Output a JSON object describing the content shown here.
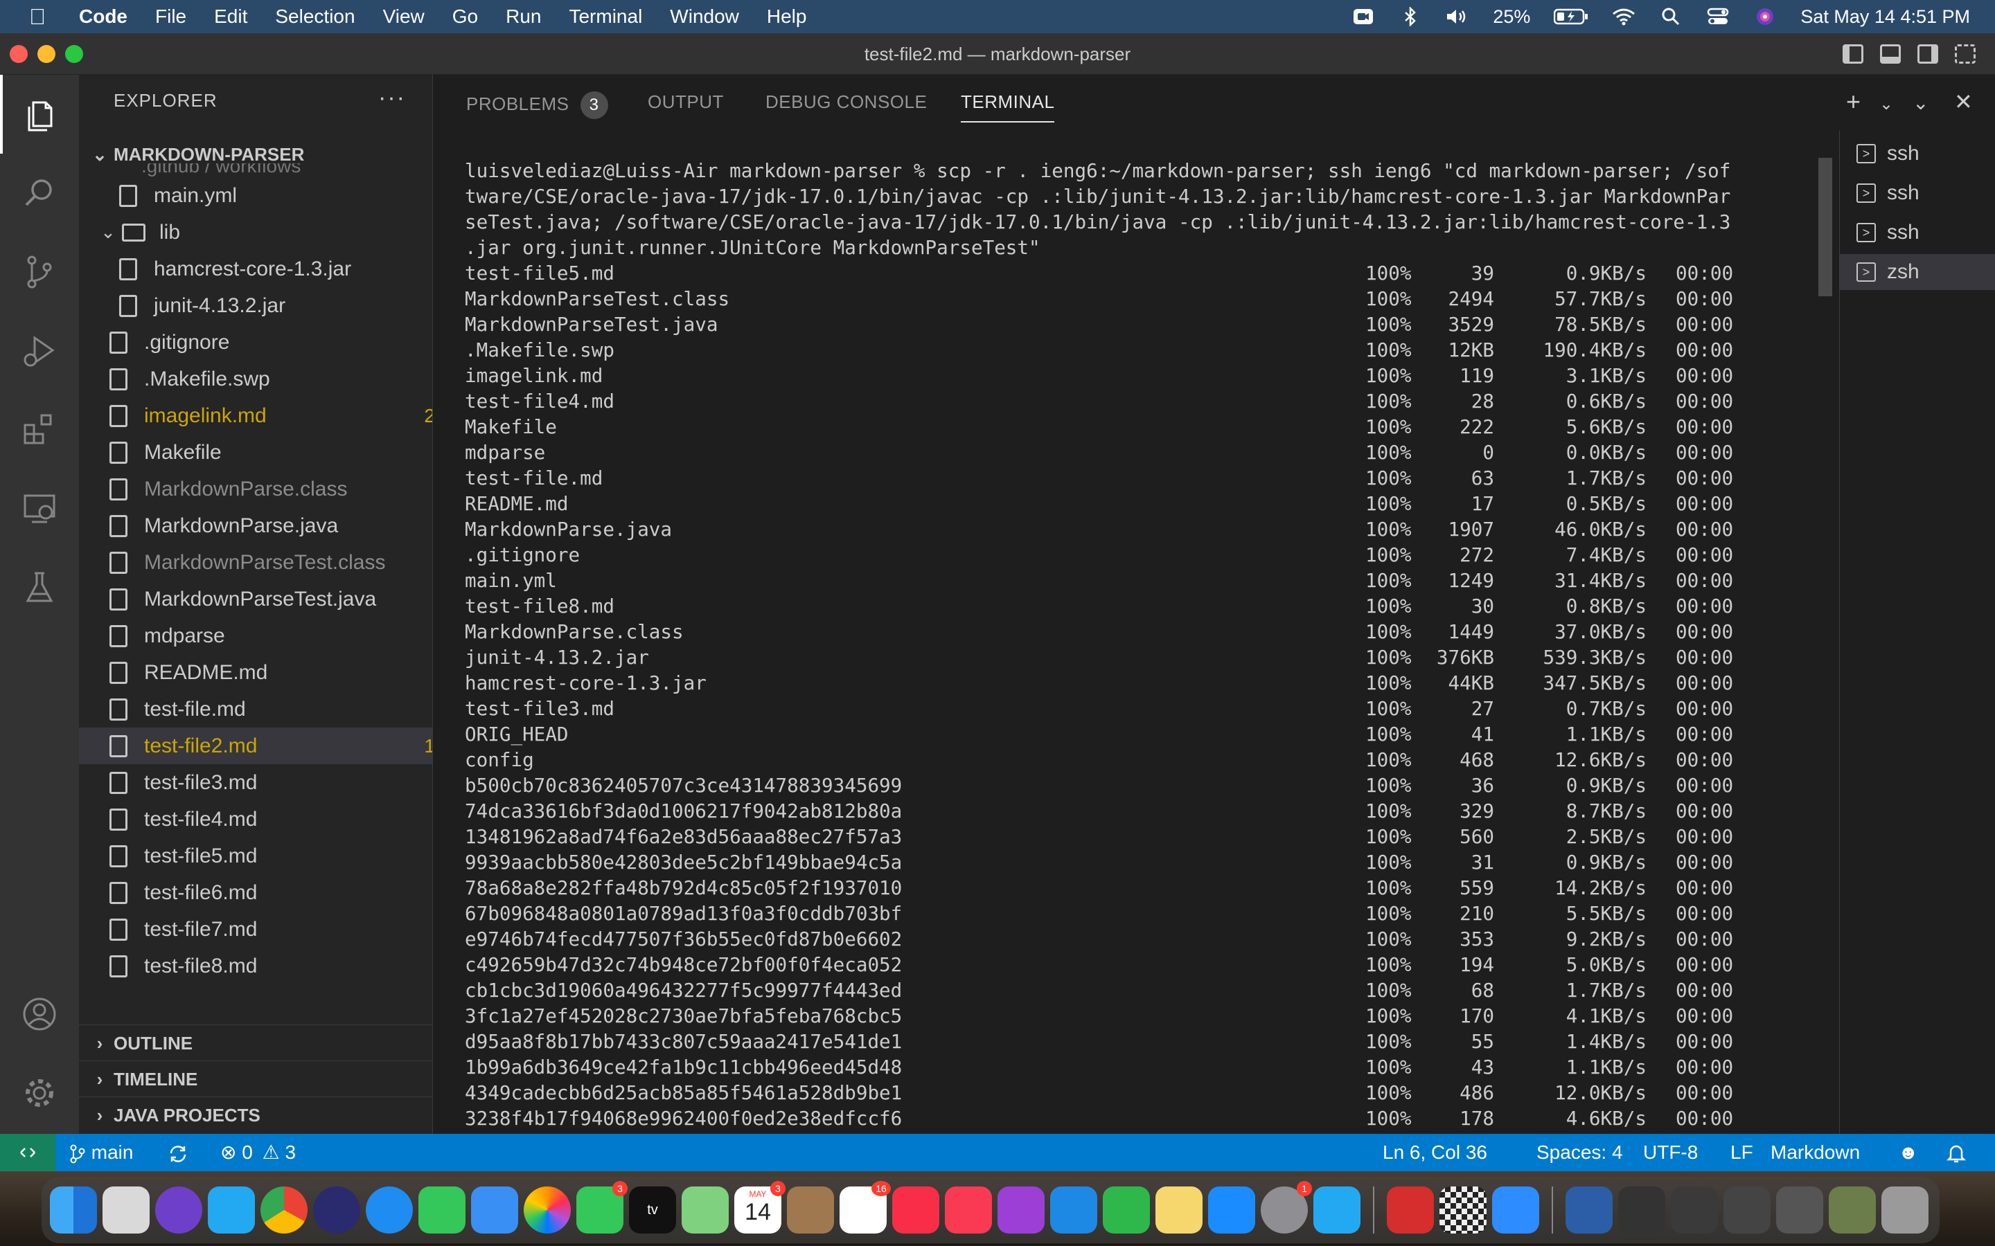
{
  "menubar": {
    "app_name": "Code",
    "items": [
      "File",
      "Edit",
      "Selection",
      "View",
      "Go",
      "Run",
      "Terminal",
      "Window",
      "Help"
    ],
    "battery": "25%",
    "clock": "Sat May 14  4:51 PM"
  },
  "window": {
    "title": "test-file2.md — markdown-parser"
  },
  "explorer": {
    "header": "EXPLORER",
    "more": "···",
    "project": "MARKDOWN-PARSER",
    "partial_folder": ".github / workflows",
    "files": [
      {
        "label": "main.yml",
        "badge": "",
        "type": "file",
        "state": "normal"
      },
      {
        "label": "lib",
        "badge": "",
        "type": "folder",
        "state": "normal"
      },
      {
        "label": "hamcrest-core-1.3.jar",
        "badge": "",
        "type": "file",
        "state": "normal"
      },
      {
        "label": "junit-4.13.2.jar",
        "badge": "",
        "type": "file",
        "state": "normal"
      },
      {
        "label": ".gitignore",
        "badge": "",
        "type": "file",
        "state": "normal"
      },
      {
        "label": ".Makefile.swp",
        "badge": "",
        "type": "file",
        "state": "normal"
      },
      {
        "label": "imagelink.md",
        "badge": "2",
        "type": "file",
        "state": "warning"
      },
      {
        "label": "Makefile",
        "badge": "",
        "type": "file",
        "state": "normal"
      },
      {
        "label": "MarkdownParse.class",
        "badge": "",
        "type": "file",
        "state": "ignored"
      },
      {
        "label": "MarkdownParse.java",
        "badge": "",
        "type": "file",
        "state": "normal"
      },
      {
        "label": "MarkdownParseTest.class",
        "badge": "",
        "type": "file",
        "state": "ignored"
      },
      {
        "label": "MarkdownParseTest.java",
        "badge": "",
        "type": "file",
        "state": "normal"
      },
      {
        "label": "mdparse",
        "badge": "",
        "type": "file",
        "state": "normal"
      },
      {
        "label": "README.md",
        "badge": "",
        "type": "file",
        "state": "normal"
      },
      {
        "label": "test-file.md",
        "badge": "",
        "type": "file",
        "state": "normal"
      },
      {
        "label": "test-file2.md",
        "badge": "1",
        "type": "file",
        "state": "selected-warning"
      },
      {
        "label": "test-file3.md",
        "badge": "",
        "type": "file",
        "state": "normal"
      },
      {
        "label": "test-file4.md",
        "badge": "",
        "type": "file",
        "state": "normal"
      },
      {
        "label": "test-file5.md",
        "badge": "",
        "type": "file",
        "state": "normal"
      },
      {
        "label": "test-file6.md",
        "badge": "",
        "type": "file",
        "state": "normal"
      },
      {
        "label": "test-file7.md",
        "badge": "",
        "type": "file",
        "state": "normal"
      },
      {
        "label": "test-file8.md",
        "badge": "",
        "type": "file",
        "state": "normal"
      }
    ],
    "sections": [
      "OUTLINE",
      "TIMELINE",
      "JAVA PROJECTS"
    ]
  },
  "panel": {
    "tabs": [
      "PROBLEMS",
      "OUTPUT",
      "DEBUG CONSOLE",
      "TERMINAL"
    ],
    "problems_count": "3",
    "active_tab": "TERMINAL"
  },
  "terminal": {
    "command_lines": [
      "luisvelediaz@Luiss-Air markdown-parser % scp -r . ieng6:~/markdown-parser; ssh ieng6 \"cd markdown-parser; /sof",
      "tware/CSE/oracle-java-17/jdk-17.0.1/bin/javac -cp .:lib/junit-4.13.2.jar:lib/hamcrest-core-1.3.jar MarkdownPar",
      "seTest.java; /software/CSE/oracle-java-17/jdk-17.0.1/bin/java -cp .:lib/junit-4.13.2.jar:lib/hamcrest-core-1.3",
      ".jar org.junit.runner.JUnitCore MarkdownParseTest\""
    ],
    "transfers": [
      {
        "name": "test-file5.md",
        "pct": "100%",
        "size": "39",
        "rate": "0.9KB/s",
        "time": "00:00"
      },
      {
        "name": "MarkdownParseTest.class",
        "pct": "100%",
        "size": "2494",
        "rate": "57.7KB/s",
        "time": "00:00"
      },
      {
        "name": "MarkdownParseTest.java",
        "pct": "100%",
        "size": "3529",
        "rate": "78.5KB/s",
        "time": "00:00"
      },
      {
        "name": ".Makefile.swp",
        "pct": "100%",
        "size": "12KB",
        "rate": "190.4KB/s",
        "time": "00:00"
      },
      {
        "name": "imagelink.md",
        "pct": "100%",
        "size": "119",
        "rate": "3.1KB/s",
        "time": "00:00"
      },
      {
        "name": "test-file4.md",
        "pct": "100%",
        "size": "28",
        "rate": "0.6KB/s",
        "time": "00:00"
      },
      {
        "name": "Makefile",
        "pct": "100%",
        "size": "222",
        "rate": "5.6KB/s",
        "time": "00:00"
      },
      {
        "name": "mdparse",
        "pct": "100%",
        "size": "0",
        "rate": "0.0KB/s",
        "time": "00:00"
      },
      {
        "name": "test-file.md",
        "pct": "100%",
        "size": "63",
        "rate": "1.7KB/s",
        "time": "00:00"
      },
      {
        "name": "README.md",
        "pct": "100%",
        "size": "17",
        "rate": "0.5KB/s",
        "time": "00:00"
      },
      {
        "name": "MarkdownParse.java",
        "pct": "100%",
        "size": "1907",
        "rate": "46.0KB/s",
        "time": "00:00"
      },
      {
        "name": ".gitignore",
        "pct": "100%",
        "size": "272",
        "rate": "7.4KB/s",
        "time": "00:00"
      },
      {
        "name": "main.yml",
        "pct": "100%",
        "size": "1249",
        "rate": "31.4KB/s",
        "time": "00:00"
      },
      {
        "name": "test-file8.md",
        "pct": "100%",
        "size": "30",
        "rate": "0.8KB/s",
        "time": "00:00"
      },
      {
        "name": "MarkdownParse.class",
        "pct": "100%",
        "size": "1449",
        "rate": "37.0KB/s",
        "time": "00:00"
      },
      {
        "name": "junit-4.13.2.jar",
        "pct": "100%",
        "size": "376KB",
        "rate": "539.3KB/s",
        "time": "00:00"
      },
      {
        "name": "hamcrest-core-1.3.jar",
        "pct": "100%",
        "size": "44KB",
        "rate": "347.5KB/s",
        "time": "00:00"
      },
      {
        "name": "test-file3.md",
        "pct": "100%",
        "size": "27",
        "rate": "0.7KB/s",
        "time": "00:00"
      },
      {
        "name": "ORIG_HEAD",
        "pct": "100%",
        "size": "41",
        "rate": "1.1KB/s",
        "time": "00:00"
      },
      {
        "name": "config",
        "pct": "100%",
        "size": "468",
        "rate": "12.6KB/s",
        "time": "00:00"
      },
      {
        "name": "b500cb70c8362405707c3ce431478839345699",
        "pct": "100%",
        "size": "36",
        "rate": "0.9KB/s",
        "time": "00:00"
      },
      {
        "name": "74dca33616bf3da0d1006217f9042ab812b80a",
        "pct": "100%",
        "size": "329",
        "rate": "8.7KB/s",
        "time": "00:00"
      },
      {
        "name": "13481962a8ad74f6a2e83d56aaa88ec27f57a3",
        "pct": "100%",
        "size": "560",
        "rate": "2.5KB/s",
        "time": "00:00"
      },
      {
        "name": "9939aacbb580e42803dee5c2bf149bbae94c5a",
        "pct": "100%",
        "size": "31",
        "rate": "0.9KB/s",
        "time": "00:00"
      },
      {
        "name": "78a68a8e282ffa48b792d4c85c05f2f1937010",
        "pct": "100%",
        "size": "559",
        "rate": "14.2KB/s",
        "time": "00:00"
      },
      {
        "name": "67b096848a0801a0789ad13f0a3f0cddb703bf",
        "pct": "100%",
        "size": "210",
        "rate": "5.5KB/s",
        "time": "00:00"
      },
      {
        "name": "e9746b74fecd477507f36b55ec0fd87b0e6602",
        "pct": "100%",
        "size": "353",
        "rate": "9.2KB/s",
        "time": "00:00"
      },
      {
        "name": "c492659b47d32c74b948ce72bf00f0f4eca052",
        "pct": "100%",
        "size": "194",
        "rate": "5.0KB/s",
        "time": "00:00"
      },
      {
        "name": "cb1cbc3d19060a496432277f5c99977f4443ed",
        "pct": "100%",
        "size": "68",
        "rate": "1.7KB/s",
        "time": "00:00"
      },
      {
        "name": "3fc1a27ef452028c2730ae7bfa5feba768cbc5",
        "pct": "100%",
        "size": "170",
        "rate": "4.1KB/s",
        "time": "00:00"
      },
      {
        "name": "d95aa8f8b17bb7433c807c59aaa2417e541de1",
        "pct": "100%",
        "size": "55",
        "rate": "1.4KB/s",
        "time": "00:00"
      },
      {
        "name": "1b99a6db3649ce42fa1b9c11cbb496eed45d48",
        "pct": "100%",
        "size": "43",
        "rate": "1.1KB/s",
        "time": "00:00"
      },
      {
        "name": "4349cadecbb6d25acb85a85f5461a528db9be1",
        "pct": "100%",
        "size": "486",
        "rate": "12.0KB/s",
        "time": "00:00"
      },
      {
        "name": "3238f4b17f94068e9962400f0ed2e38edfccf6",
        "pct": "100%",
        "size": "178",
        "rate": "4.6KB/s",
        "time": "00:00"
      }
    ],
    "sessions": [
      {
        "label": "ssh",
        "selected": false
      },
      {
        "label": "ssh",
        "selected": false
      },
      {
        "label": "ssh",
        "selected": false
      },
      {
        "label": "zsh",
        "selected": true
      }
    ]
  },
  "statusbar": {
    "branch": "main",
    "errors": "0",
    "warnings": "3",
    "position": "Ln 6, Col 36",
    "spaces": "Spaces: 4",
    "encoding": "UTF-8",
    "eol": "LF",
    "language": "Markdown"
  },
  "dock": {
    "calendar_month": "MAY",
    "calendar_day": "14",
    "badges": {
      "messages": "3",
      "calendar": "3",
      "reminders": "16",
      "settings": "1"
    }
  },
  "colors": {
    "accent": "#007acc",
    "warning": "#cca700",
    "ignored": "#8c8c8c",
    "selection": "#37373d"
  }
}
